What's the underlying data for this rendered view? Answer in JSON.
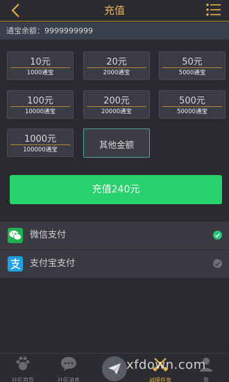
{
  "header": {
    "title": "充值"
  },
  "balance": {
    "label": "通宝余额：",
    "value": "9999999999"
  },
  "amounts": [
    {
      "price": "10元",
      "coins": "1000通宝"
    },
    {
      "price": "20元",
      "coins": "2000通宝"
    },
    {
      "price": "50元",
      "coins": "5000通宝"
    },
    {
      "price": "100元",
      "coins": "10000通宝"
    },
    {
      "price": "200元",
      "coins": "20000通宝"
    },
    {
      "price": "500元",
      "coins": "50000通宝"
    },
    {
      "price": "1000元",
      "coins": "100000通宝"
    }
  ],
  "other_amount_label": "其他金额",
  "pay_button_label": "充值240元",
  "payment_methods": [
    {
      "label": "微信支付",
      "icon": "wechat-icon",
      "selected": true
    },
    {
      "label": "支付宝支付",
      "icon": "alipay-icon",
      "selected": false
    }
  ],
  "bottom_nav": [
    {
      "label": "社区首页",
      "icon": "community-icon"
    },
    {
      "label": "社区消息",
      "icon": "message-icon"
    },
    {
      "label": "",
      "icon": "send-icon"
    },
    {
      "label": "战境任务",
      "icon": "task-icon"
    },
    {
      "label": "我",
      "icon": "profile-icon"
    }
  ],
  "watermark": "xfdown.com",
  "colors": {
    "accent": "#e8b34a",
    "pay_green": "#27d26c",
    "wechat_green": "#21b14f",
    "alipay_blue": "#1e9fe6",
    "selected_check": "#27c47a",
    "unselected_check": "#6e6e78"
  }
}
